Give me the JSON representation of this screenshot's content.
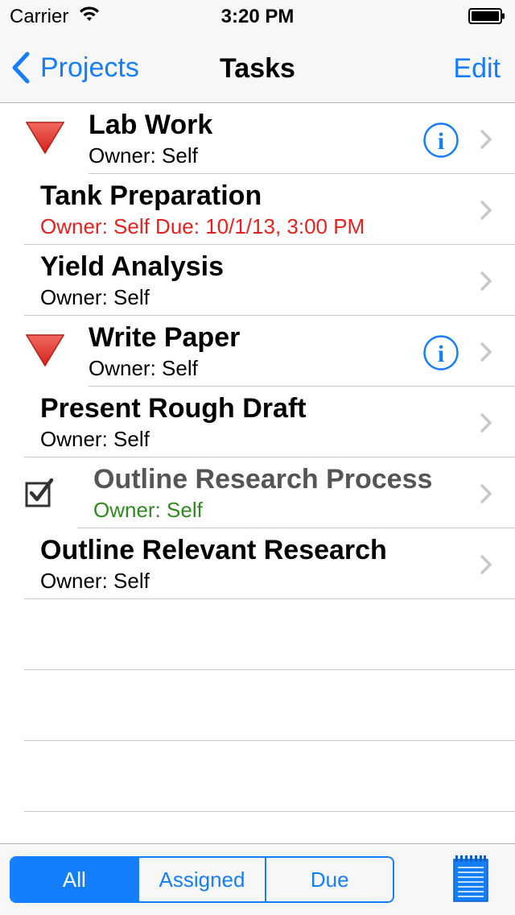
{
  "status_bar": {
    "carrier": "Carrier",
    "time": "3:20 PM"
  },
  "nav": {
    "back_label": "Projects",
    "title": "Tasks",
    "edit_label": "Edit"
  },
  "tasks": [
    {
      "title": "Lab Work",
      "subtitle": "Owner: Self",
      "kind": "parent",
      "subtitle_color": "#000000"
    },
    {
      "title": "Tank Preparation",
      "subtitle": "Owner: Self Due: 10/1/13, 3:00 PM",
      "kind": "child",
      "subtitle_color": "#e8211e"
    },
    {
      "title": "Yield Analysis",
      "subtitle": "Owner: Self",
      "kind": "child",
      "subtitle_color": "#000000"
    },
    {
      "title": "Write Paper",
      "subtitle": "Owner: Self",
      "kind": "parent",
      "subtitle_color": "#000000"
    },
    {
      "title": "Present Rough Draft",
      "subtitle": "Owner: Self",
      "kind": "child",
      "subtitle_color": "#000000"
    },
    {
      "title": "Outline Research Process",
      "subtitle": "Owner: Self",
      "kind": "completed",
      "subtitle_color": "#2e8b1e"
    },
    {
      "title": "Outline Relevant Research",
      "subtitle": "Owner: Self",
      "kind": "child",
      "subtitle_color": "#000000"
    }
  ],
  "toolbar": {
    "segments": [
      "All",
      "Assigned",
      "Due"
    ],
    "selected": "All"
  },
  "colors": {
    "accent": "#157efb",
    "overdue": "#e8211e",
    "completed": "#2e8b1e",
    "triangle": "#e0322b"
  }
}
